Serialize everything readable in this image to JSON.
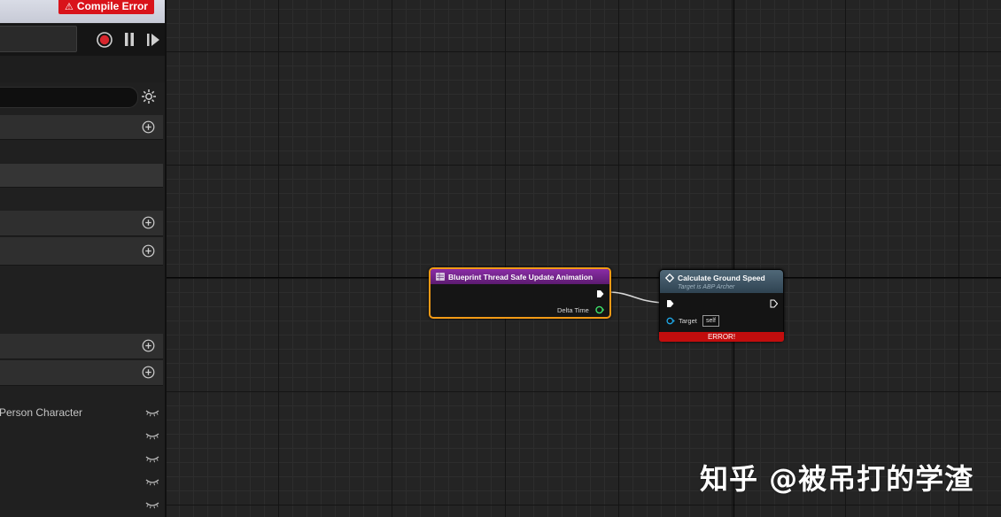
{
  "toolbar": {
    "compile_error_label": "Compile Error"
  },
  "left_panel": {
    "variables": [
      {
        "label": "Person Character"
      },
      {
        "label": ""
      },
      {
        "label": ""
      },
      {
        "label": ""
      },
      {
        "label": ""
      }
    ]
  },
  "graph": {
    "nodes": {
      "update_animation": {
        "title": "Blueprint Thread Safe Update Animation",
        "output_pin": "Delta Time"
      },
      "calculate_ground_speed": {
        "title": "Calculate Ground Speed",
        "subtitle": "Target is ABP Archer",
        "target_label": "Target",
        "target_value": "self",
        "error_label": "ERROR!"
      }
    }
  },
  "watermark": "知乎 @被吊打的学渣",
  "colors": {
    "compile_error_bg": "#d9131a",
    "node_selected_border": "#f29a16",
    "pure_function_header": "#8a2ca6",
    "function_call_header": "#506878",
    "error_bar": "#c20d0d",
    "float_pin": "#3ee26b",
    "object_pin": "#1fa7e6"
  },
  "icons": [
    "warning-icon",
    "record-icon",
    "pause-icon",
    "step-icon",
    "settings-icon",
    "plus-icon",
    "eye-closed-icon",
    "function-icon",
    "exec-pin-icon",
    "float-pin-icon",
    "object-pin-icon"
  ]
}
